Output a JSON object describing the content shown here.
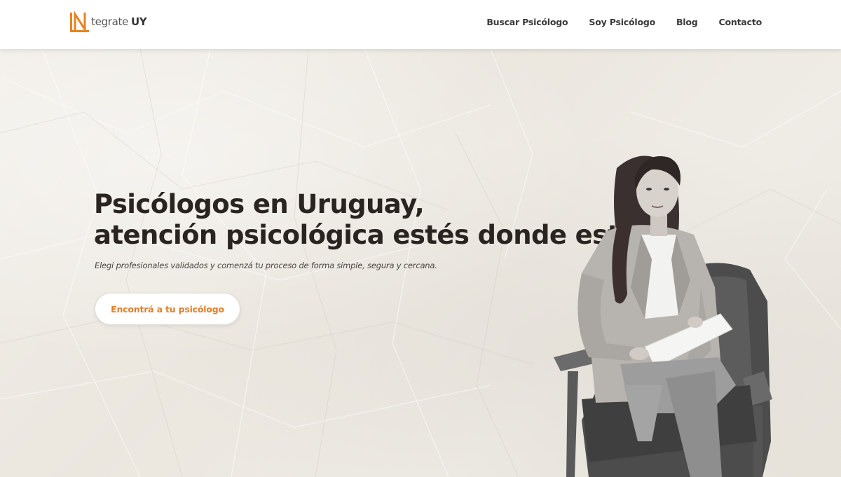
{
  "brand": {
    "logo_mark": "IN",
    "name_text": "tegrate",
    "name_suffix": "UY",
    "accent": "#e8831f"
  },
  "nav": {
    "items": [
      "Buscar Psicólogo",
      "Soy Psicólogo",
      "Blog",
      "Contacto"
    ]
  },
  "hero": {
    "title_line1": "Psicólogos en Uruguay,",
    "title_line2": "atención psicológica estés donde estés",
    "subtitle": "Elegí profesionales validados y comenzá tu proceso de forma simple, segura y cercana.",
    "cta_label": "Encontrá a tu psicólogo",
    "cta_color": "#e47f2a",
    "image_subject": "woman-seated-in-armchair-holding-papers"
  }
}
